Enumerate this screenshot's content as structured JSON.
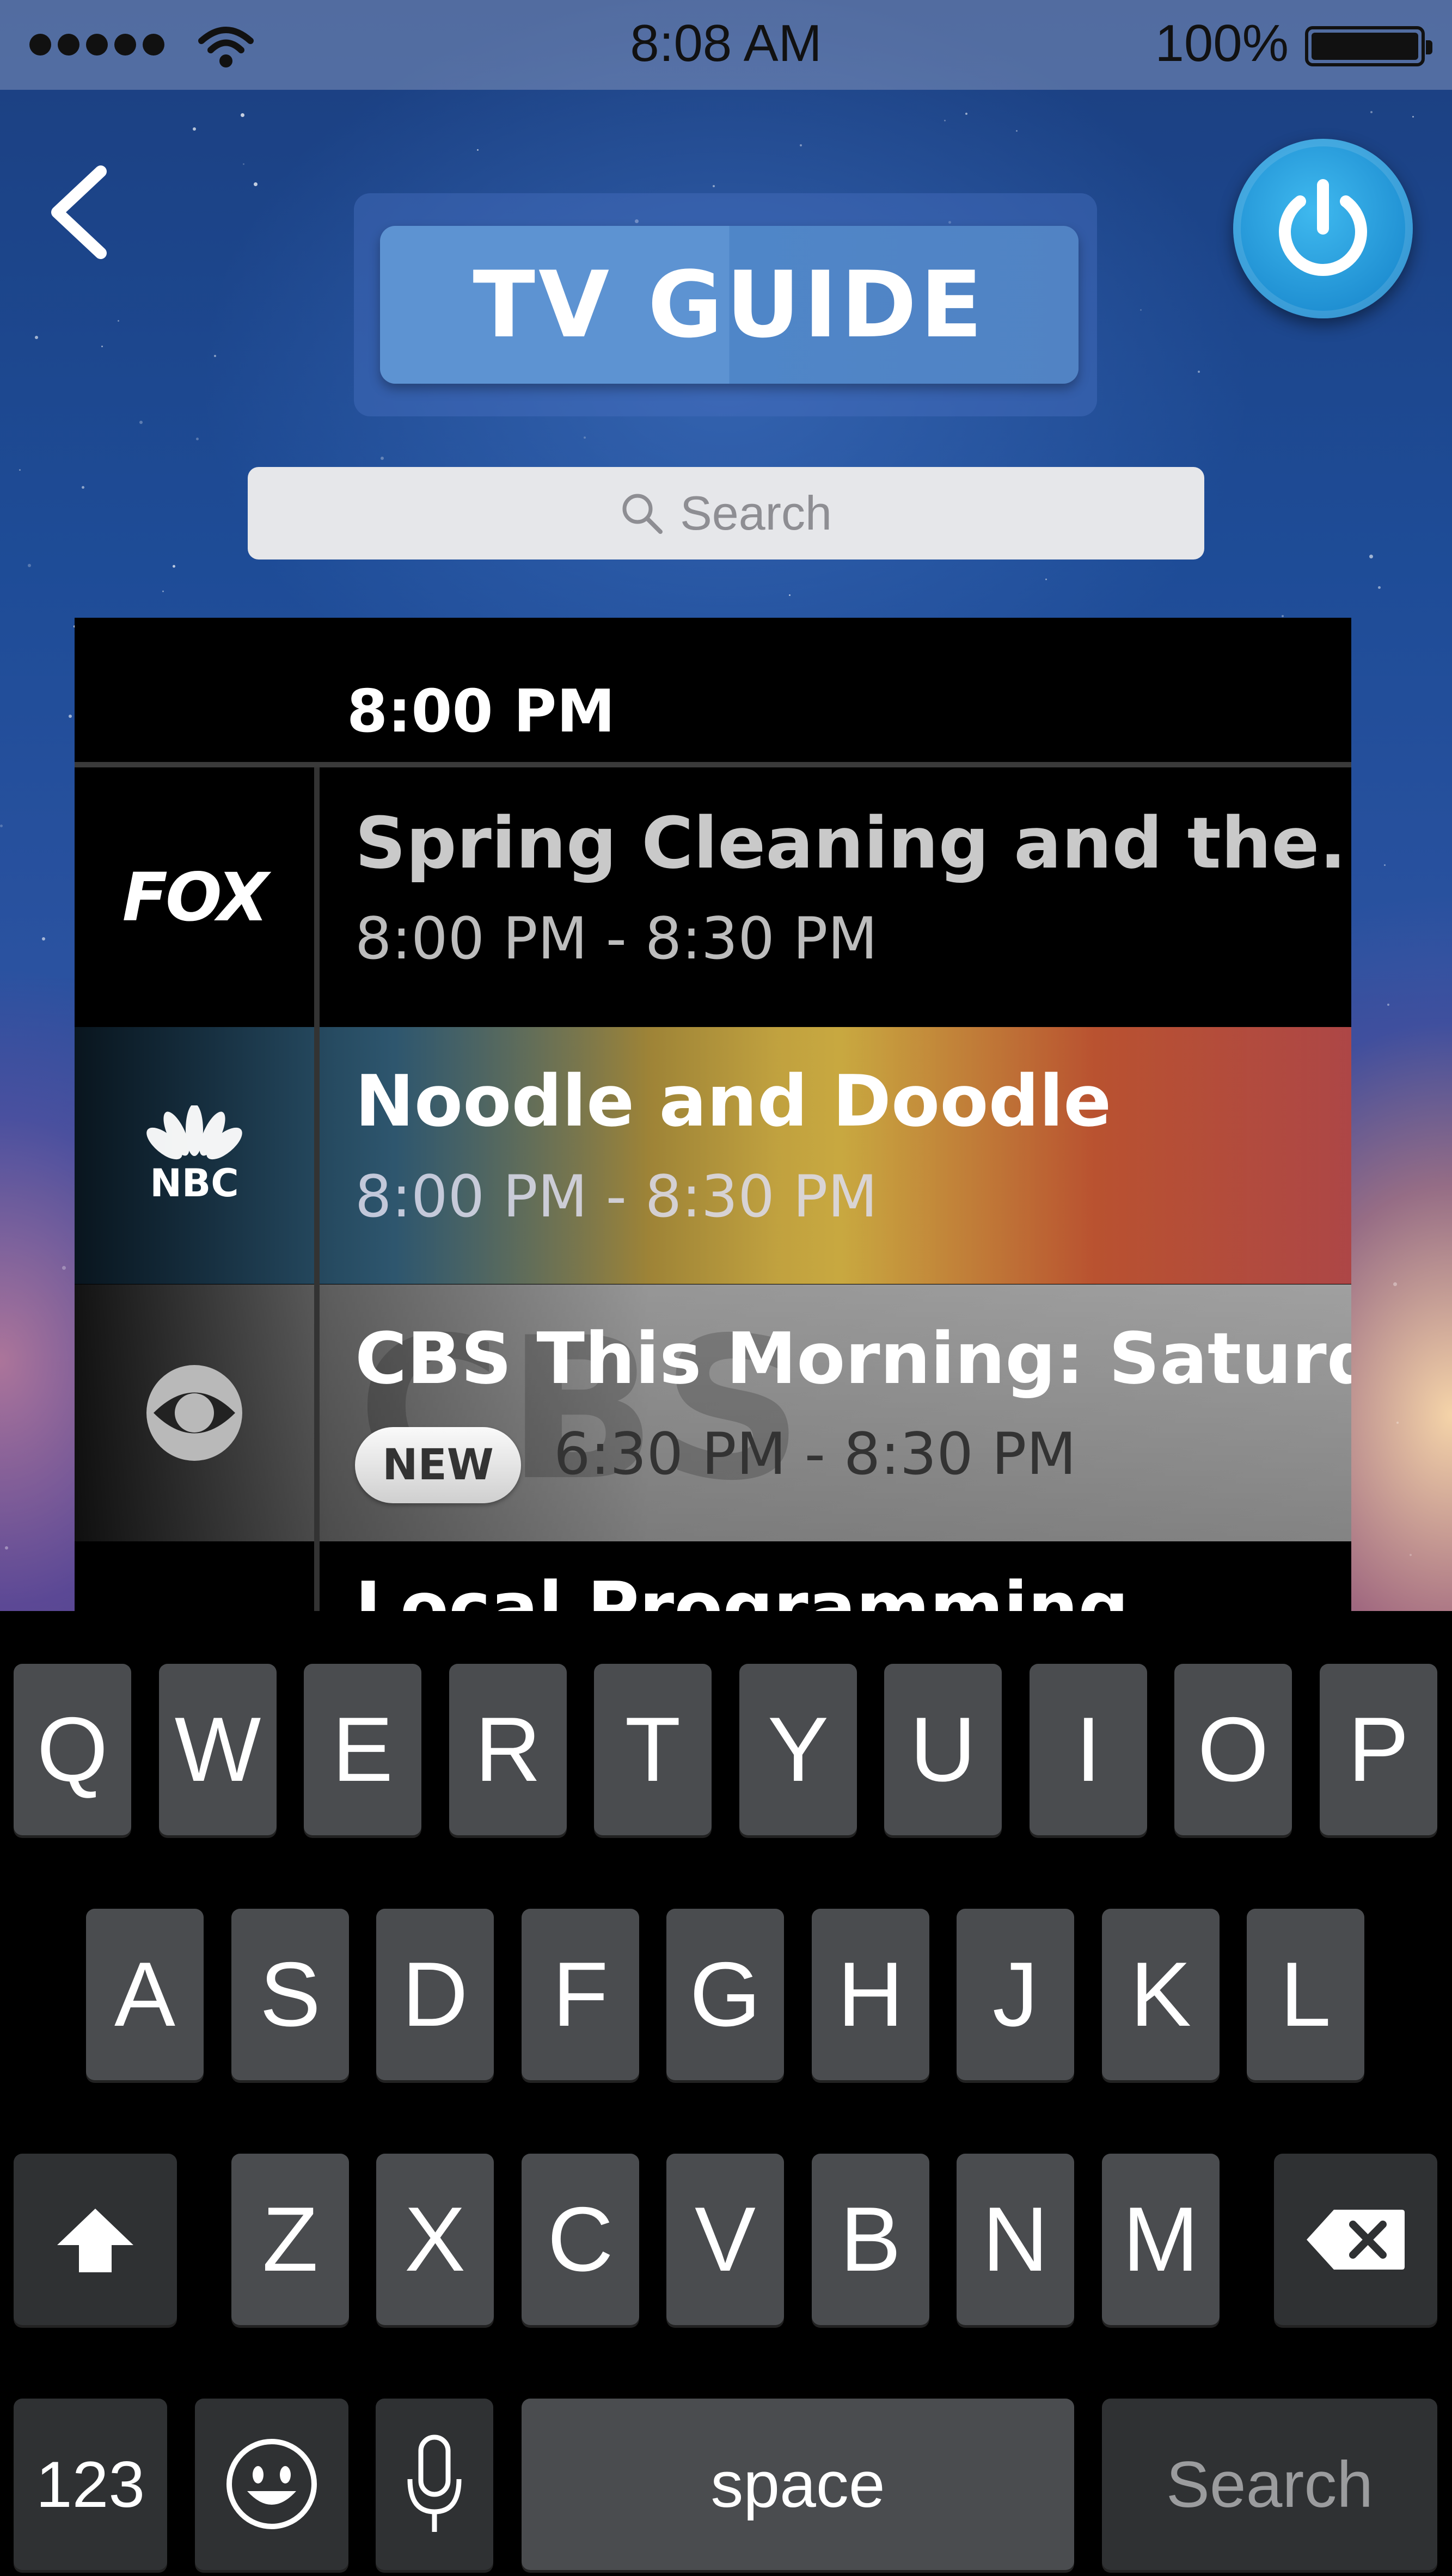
{
  "status_bar": {
    "time": "8:08 AM",
    "battery_percent": "100%",
    "signal_bars": 5,
    "icons": [
      "signal-dots-icon",
      "wifi-icon",
      "battery-icon"
    ]
  },
  "header": {
    "back_icon": "chevron-left-icon",
    "title": "TV GUIDE",
    "power_icon": "power-icon"
  },
  "search": {
    "placeholder": "Search",
    "icon": "magnifier-icon"
  },
  "guide": {
    "time_slot": "8:00 PM",
    "rows": [
      {
        "channel": "FOX",
        "title": "Spring Cleaning and the...",
        "time": "8:00 PM - 8:30 PM"
      },
      {
        "channel": "NBC",
        "title": "Noodle and Doodle",
        "time": "8:00 PM - 8:30 PM"
      },
      {
        "channel": "CBS",
        "title": "CBS This Morning: Saturd...",
        "badge": "NEW",
        "time": "6:30 PM - 8:30 PM"
      },
      {
        "channel": "",
        "title": "Local Programming",
        "time": ""
      }
    ]
  },
  "keyboard": {
    "row1": [
      "Q",
      "W",
      "E",
      "R",
      "T",
      "Y",
      "U",
      "I",
      "O",
      "P"
    ],
    "row2": [
      "A",
      "S",
      "D",
      "F",
      "G",
      "H",
      "J",
      "K",
      "L"
    ],
    "row3": [
      "Z",
      "X",
      "C",
      "V",
      "B",
      "N",
      "M"
    ],
    "numbers_key": "123",
    "space_key": "space",
    "search_key": "Search",
    "icons": [
      "shift-icon",
      "backspace-icon",
      "emoji-icon",
      "microphone-icon"
    ]
  },
  "colors": {
    "title_pill": "#5d93d2",
    "power_button": "#1f8fd2",
    "search_bar": "#e6e7ea",
    "key": "#4a4c4f",
    "key_dark": "#2f3133"
  }
}
